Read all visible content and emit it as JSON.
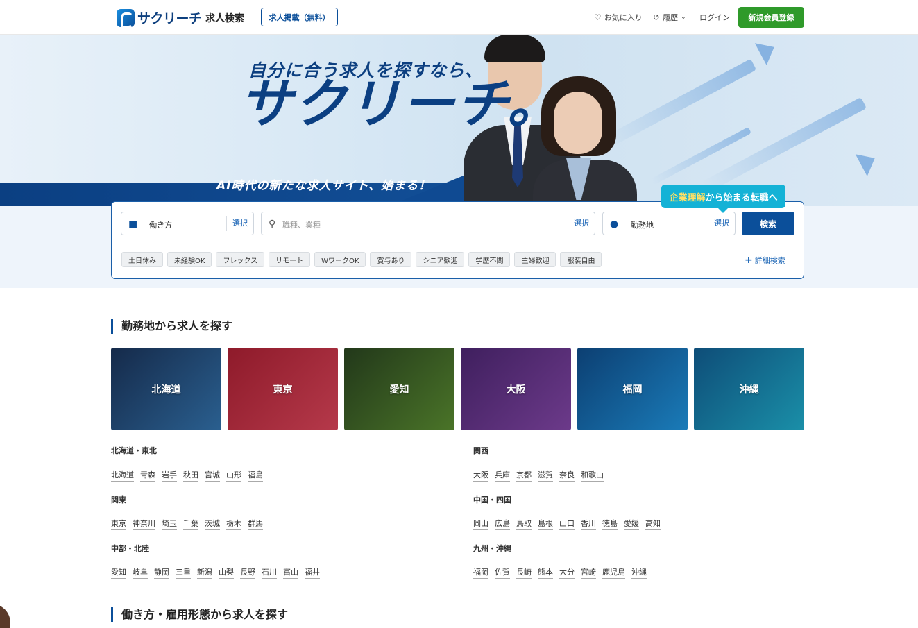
{
  "header": {
    "logo_text": "サクリーチ",
    "nav_search": "求人検索",
    "post_button": "求人掲載（無料）",
    "favorites": "お気に入り",
    "history": "履歴",
    "login": "ログイン",
    "signup": "新規会員登録"
  },
  "hero": {
    "subtitle": "自分に合う求人を探すなら、",
    "title": "サクリーチ。",
    "tagline": "AI時代の新たな求人サイト、始まる！"
  },
  "balloon": {
    "highlight": "企業理解",
    "rest": "から始まる転職へ"
  },
  "search": {
    "work_style_label": "働き方",
    "work_style_select": "選択",
    "keyword_placeholder": "職種、業種",
    "keyword_select": "選択",
    "location_label": "勤務地",
    "location_select": "選択",
    "search_button": "検索",
    "tags": [
      "土日休み",
      "未経験OK",
      "フレックス",
      "リモート",
      "WワークOK",
      "賞与あり",
      "シニア歓迎",
      "学歴不問",
      "主婦歓迎",
      "服装自由"
    ],
    "detail_link": "詳細検索"
  },
  "location_section": {
    "title": "勤務地から求人を探す",
    "tiles": [
      "北海道",
      "東京",
      "愛知",
      "大阪",
      "福岡",
      "沖縄"
    ],
    "regions": [
      {
        "name": "北海道・東北",
        "prefs": [
          "北海道",
          "青森",
          "岩手",
          "秋田",
          "宮城",
          "山形",
          "福島"
        ]
      },
      {
        "name": "関東",
        "prefs": [
          "東京",
          "神奈川",
          "埼玉",
          "千葉",
          "茨城",
          "栃木",
          "群馬"
        ]
      },
      {
        "name": "中部・北陸",
        "prefs": [
          "愛知",
          "岐阜",
          "静岡",
          "三重",
          "新潟",
          "山梨",
          "長野",
          "石川",
          "富山",
          "福井"
        ]
      },
      {
        "name": "関西",
        "prefs": [
          "大阪",
          "兵庫",
          "京都",
          "滋賀",
          "奈良",
          "和歌山"
        ]
      },
      {
        "name": "中国・四国",
        "prefs": [
          "岡山",
          "広島",
          "鳥取",
          "島根",
          "山口",
          "香川",
          "徳島",
          "愛媛",
          "高知"
        ]
      },
      {
        "name": "九州・沖縄",
        "prefs": [
          "福岡",
          "佐賀",
          "長崎",
          "熊本",
          "大分",
          "宮崎",
          "鹿児島",
          "沖縄"
        ]
      }
    ]
  },
  "work_section": {
    "title": "働き方・雇用形態から求人を探す"
  },
  "colors": {
    "brand": "#0b4f9a",
    "signup": "#2f9a2a",
    "balloon": "#14b2d6"
  }
}
